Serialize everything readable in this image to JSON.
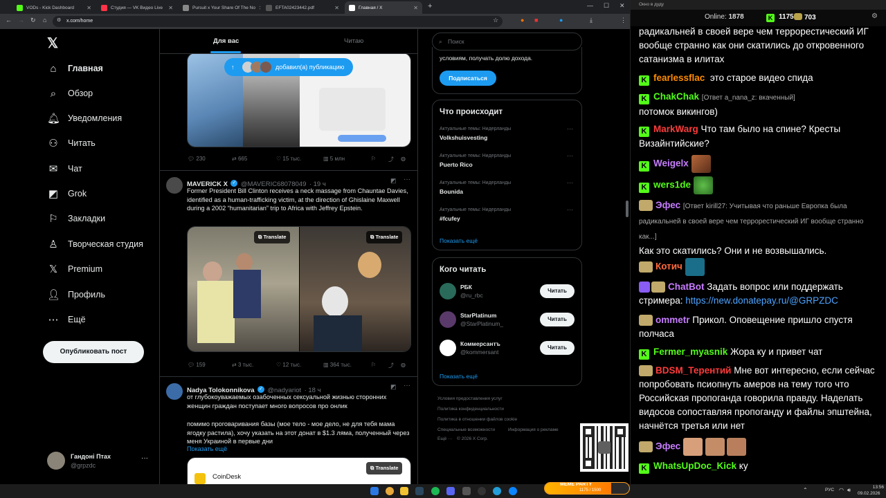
{
  "browser": {
    "tabs": [
      {
        "label": "VODs - Kick Dashboard",
        "color": "#53fc18"
      },
      {
        "label": "Студия — VK Видео Live",
        "color": "#ff3347"
      },
      {
        "label": "Pursuit x Your Share Of The No",
        "color": "#888888"
      },
      {
        "label": "EFTA02423442.pdf",
        "color": "#555555"
      },
      {
        "label": "Главная / X",
        "color": "#ffffff"
      }
    ],
    "url": "x.com/home"
  },
  "nav": {
    "items": [
      {
        "label": "Главная",
        "icon": "home-icon",
        "glyph": "⌂"
      },
      {
        "label": "Обзор",
        "icon": "search-icon",
        "glyph": "⌕"
      },
      {
        "label": "Уведомления",
        "icon": "bell-icon",
        "glyph": "🔔︎"
      },
      {
        "label": "Читать",
        "icon": "add-user-icon",
        "glyph": "⚇"
      },
      {
        "label": "Чат",
        "icon": "mail-icon",
        "glyph": "✉"
      },
      {
        "label": "Grok",
        "icon": "grok-icon",
        "glyph": "◩"
      },
      {
        "label": "Закладки",
        "icon": "bookmark-icon",
        "glyph": "⚐"
      },
      {
        "label": "Творческая студия",
        "icon": "studio-icon",
        "glyph": "♙"
      },
      {
        "label": "Premium",
        "icon": "x-premium-icon",
        "glyph": "𝕏"
      },
      {
        "label": "Профиль",
        "icon": "profile-icon",
        "glyph": "👤︎"
      },
      {
        "label": "Ещё",
        "icon": "more-icon",
        "glyph": "⋯"
      }
    ],
    "post_button": "Опубликовать пост",
    "account": {
      "name": "Гандоні Птах",
      "handle": "@grpzdc"
    }
  },
  "feed": {
    "tabs": [
      "Для вас",
      "Читаю"
    ],
    "new_posts": "добавил(а) публикацию",
    "post1_stats": {
      "replies": "230",
      "reposts": "665",
      "likes": "15 тыс.",
      "views": "5 млн"
    },
    "post2": {
      "name": "MAVERICK X",
      "handle": "@MAVERIC68078049",
      "time": "· 19 ч",
      "text": "Former President Bill Clinton receives a neck massage from Chauntae Davies, identified as a human-trafficking victim, at the direction of Ghislaine Maxwell during a 2002 “humanitarian” trip to Africa with Jeffrey Epstein.",
      "translate": "Translate",
      "stats": {
        "replies": "159",
        "reposts": "3 тыс.",
        "likes": "12 тыс.",
        "views": "364 тыс."
      }
    },
    "post3": {
      "name": "Nadya Tolokonnikova",
      "handle": "@nadyariot",
      "time": "· 18 ч",
      "text1": "от глубокоуважаемых озабоченных сексуальной жизнью сторонних женщин граждан поступает много вопросов про онлик",
      "text2": "помимо проговаривания базы (мое тело - мое дело, не для тебя мама ягодку растила), хочу указать на этот донат в $1.3 ляма, полученный через меня Украиной в первые дни",
      "show_more": "Показать ещё",
      "card_name": "CoinDesk",
      "translate": "Translate"
    }
  },
  "right": {
    "search_placeholder": "Поиск",
    "premium_text": "условиям, получать долю дохода.",
    "subscribe": "Подписаться",
    "trends_title": "Что происходит",
    "trends": [
      {
        "context": "Актуальные темы: Нидерланды",
        "name": "Volkshuisvesting"
      },
      {
        "context": "Актуальные темы: Нидерланды",
        "name": "Puerto Rico"
      },
      {
        "context": "Актуальные темы: Нидерланды",
        "name": "Bounida"
      },
      {
        "context": "Актуальные темы: Нидерланды",
        "name": "#fcufey"
      }
    ],
    "show_more": "Показать ещё",
    "who_title": "Кого читать",
    "who": [
      {
        "name": "РБК",
        "handle": "@ru_rbc",
        "button": "Читать"
      },
      {
        "name": "StarPlatinum",
        "handle": "@StarPlatinum_",
        "button": "Читать"
      },
      {
        "name": "Коммерсантъ",
        "handle": "@kommersant",
        "button": "Читать"
      }
    ],
    "footer": [
      "Условия предоставления услуг",
      "Политика конфиденциальности",
      "Политика в отношении файлов cookie",
      "Специальные возможности",
      "Информация о рекламе",
      "Ещё ···",
      "© 2026 X Corp."
    ]
  },
  "chat": {
    "window_title": "Окно в дуду",
    "online_label": "Online:",
    "online": "1878",
    "kick_count": "1175",
    "other_count": "703",
    "messages": [
      {
        "text": "радикальней в своей вере чем террорестический ИГ вообще странно как они скатились до откровенного сатанизма в илитах"
      },
      {
        "user": "fearlessflac",
        "color": "#ff8c00",
        "text": "это старое видео спида"
      },
      {
        "user": "ChakChak",
        "color": "#53fc18",
        "reply": "[Ответ a_nana_z: вкаченный]",
        "text": "потомок викингов)"
      },
      {
        "user": "MarkWarg",
        "color": "#ff3b3b",
        "text": "Что там было на спине? Кресты Визайнтийские?"
      },
      {
        "user": "Weigelx",
        "color": "#c77dff",
        "text": ""
      },
      {
        "user": "wers1de",
        "color": "#53fc18",
        "text": ""
      },
      {
        "user": "Эфес",
        "color": "#c77dff",
        "reply": "[Ответ kirill27: Учитывая что раньше Европка была радикальней в своей вере чем террорестический ИГ вообще странно как...]",
        "text": "Как это скатились? Они и не возвышались."
      },
      {
        "user": "Котич",
        "color": "#ff6a3d",
        "text": ""
      },
      {
        "user": "ChatBot",
        "color": "#c77dff",
        "text": "Задать вопрос или поддержать стримера: ",
        "link": "https://new.donatepay.ru/@GRPZDC"
      },
      {
        "user": "ommetr",
        "color": "#c77dff",
        "text": "Прикол. Оповещение пришло спустя полчаса"
      },
      {
        "user": "Fermer_myasnik",
        "color": "#53fc18",
        "text": "Жора ку и привет чат"
      },
      {
        "user": "BDSM_Терентий",
        "color": "#ff3b3b",
        "text": "Мне вот интересно, если сейчас попробовать псиопнуть амеров на тему того что Российская пропоганда говорила правду. Наделать видосов сопоставляя пропоганду и файлы эпштейна, начнётся третья или нет"
      },
      {
        "user": "Эфес",
        "color": "#c77dff",
        "text": ""
      },
      {
        "user": "WhatsUpDoc_Kick",
        "color": "#53fc18",
        "text": "ку"
      }
    ]
  },
  "overlay": {
    "meme_party": "MEME PARTY",
    "meme_progress": "1175 / 1500"
  },
  "taskbar": {
    "lang": "РУС",
    "time": "13:56",
    "date": "09.02.2026"
  }
}
